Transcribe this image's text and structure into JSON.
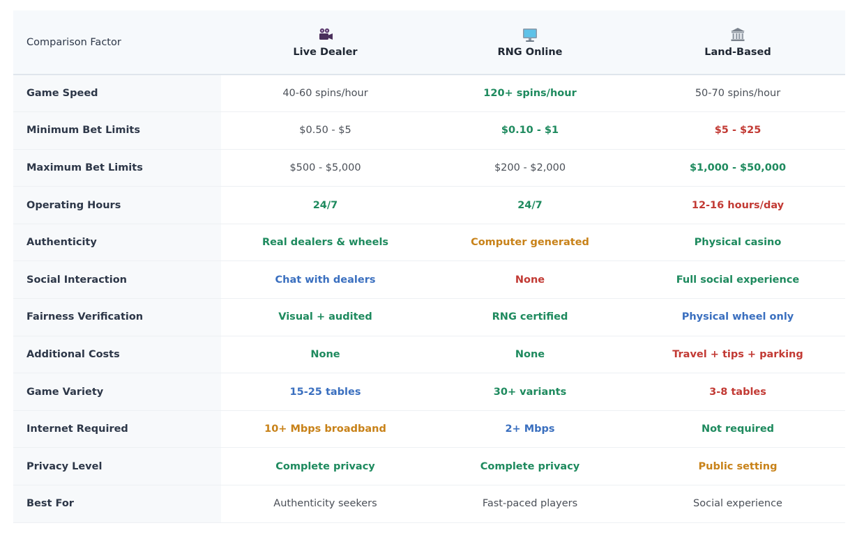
{
  "header": {
    "factor_label": "Comparison Factor",
    "columns": [
      {
        "label": "Live Dealer",
        "icon": "movie-camera-icon"
      },
      {
        "label": "RNG Online",
        "icon": "computer-monitor-icon"
      },
      {
        "label": "Land-Based",
        "icon": "bank-building-icon"
      }
    ]
  },
  "status_colors": {
    "green": "#1e8a5e",
    "red": "#c23a34",
    "orange": "#c88219",
    "blue": "#3a6fbf",
    "plain": "#4a4f57"
  },
  "rows": [
    {
      "factor": "Game Speed",
      "cells": [
        {
          "text": "40-60 spins/hour",
          "status": "plain"
        },
        {
          "text": "120+ spins/hour",
          "status": "green"
        },
        {
          "text": "50-70 spins/hour",
          "status": "plain"
        }
      ]
    },
    {
      "factor": "Minimum Bet Limits",
      "cells": [
        {
          "text": "$0.50 - $5",
          "status": "plain"
        },
        {
          "text": "$0.10 - $1",
          "status": "green"
        },
        {
          "text": "$5 - $25",
          "status": "red"
        }
      ]
    },
    {
      "factor": "Maximum Bet Limits",
      "cells": [
        {
          "text": "$500 - $5,000",
          "status": "plain"
        },
        {
          "text": "$200 - $2,000",
          "status": "plain"
        },
        {
          "text": "$1,000 - $50,000",
          "status": "green"
        }
      ]
    },
    {
      "factor": "Operating Hours",
      "cells": [
        {
          "text": "24/7",
          "status": "green"
        },
        {
          "text": "24/7",
          "status": "green"
        },
        {
          "text": "12-16 hours/day",
          "status": "red"
        }
      ]
    },
    {
      "factor": "Authenticity",
      "cells": [
        {
          "text": "Real dealers & wheels",
          "status": "green"
        },
        {
          "text": "Computer generated",
          "status": "orange"
        },
        {
          "text": "Physical casino",
          "status": "green"
        }
      ]
    },
    {
      "factor": "Social Interaction",
      "cells": [
        {
          "text": "Chat with dealers",
          "status": "blue"
        },
        {
          "text": "None",
          "status": "red"
        },
        {
          "text": "Full social experience",
          "status": "green"
        }
      ]
    },
    {
      "factor": "Fairness Verification",
      "cells": [
        {
          "text": "Visual + audited",
          "status": "green"
        },
        {
          "text": "RNG certified",
          "status": "green"
        },
        {
          "text": "Physical wheel only",
          "status": "blue"
        }
      ]
    },
    {
      "factor": "Additional Costs",
      "cells": [
        {
          "text": "None",
          "status": "green"
        },
        {
          "text": "None",
          "status": "green"
        },
        {
          "text": "Travel + tips + parking",
          "status": "red"
        }
      ]
    },
    {
      "factor": "Game Variety",
      "cells": [
        {
          "text": "15-25 tables",
          "status": "blue"
        },
        {
          "text": "30+ variants",
          "status": "green"
        },
        {
          "text": "3-8 tables",
          "status": "red"
        }
      ]
    },
    {
      "factor": "Internet Required",
      "cells": [
        {
          "text": "10+ Mbps broadband",
          "status": "orange"
        },
        {
          "text": "2+ Mbps",
          "status": "blue"
        },
        {
          "text": "Not required",
          "status": "green"
        }
      ]
    },
    {
      "factor": "Privacy Level",
      "cells": [
        {
          "text": "Complete privacy",
          "status": "green"
        },
        {
          "text": "Complete privacy",
          "status": "green"
        },
        {
          "text": "Public setting",
          "status": "orange"
        }
      ]
    },
    {
      "factor": "Best For",
      "cells": [
        {
          "text": "Authenticity seekers",
          "status": "plain"
        },
        {
          "text": "Fast-paced players",
          "status": "plain"
        },
        {
          "text": "Social experience",
          "status": "plain"
        }
      ]
    }
  ]
}
